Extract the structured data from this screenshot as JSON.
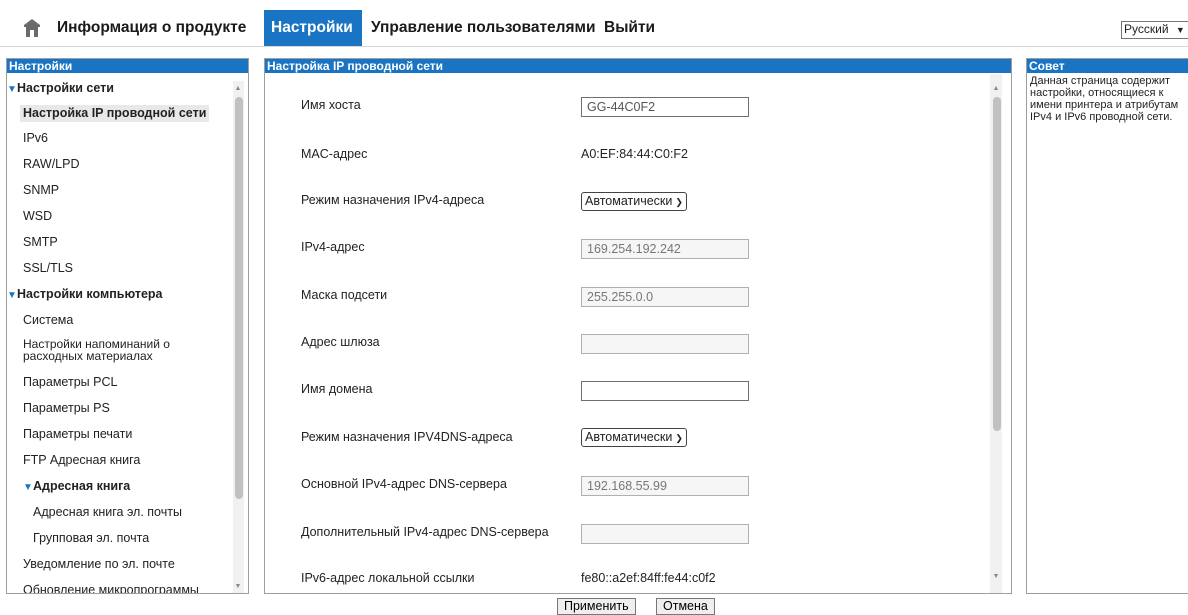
{
  "nav": {
    "product_info": "Информация о продукте",
    "settings": "Настройки",
    "user_management": "Управление пользователями",
    "logout": "Выйти",
    "language": "Русский"
  },
  "sidebar": {
    "title": "Настройки",
    "network_settings": "Настройки сети",
    "wired_ip": "Настройка IP проводной сети",
    "ipv6": "IPv6",
    "rawlpd": "RAW/LPD",
    "snmp": "SNMP",
    "wsd": "WSD",
    "smtp": "SMTP",
    "ssltls": "SSL/TLS",
    "computer_settings": "Настройки компьютера",
    "system": "Система",
    "supply_reminder_l1": "Настройки напоминаний о",
    "supply_reminder_l2": "расходных материалах",
    "pcl": "Параметры PCL",
    "ps": "Параметры PS",
    "print": "Параметры печати",
    "ftp": "FTP Адресная книга",
    "address_book": "Адресная книга",
    "email_book": "Адресная книга эл. почты",
    "group_email": "Групповая эл. почта",
    "email_notify": "Уведомление по эл. почте",
    "firmware": "Обновление микропрограммы"
  },
  "main": {
    "title": "Настройка IP проводной сети",
    "hostname_label": "Имя хоста",
    "hostname_value": "GG-44C0F2",
    "mac_label": "MAC-адрес",
    "mac_value": "A0:EF:84:44:C0:F2",
    "ipv4_mode_label": "Режим назначения IPv4-адреса",
    "ipv4_mode_value": "Автоматически",
    "ipv4_label": "IPv4-адрес",
    "ipv4_value": "169.254.192.242",
    "mask_label": "Маска подсети",
    "mask_value": "255.255.0.0",
    "gateway_label": "Адрес шлюза",
    "gateway_value": "",
    "domain_label": "Имя домена",
    "domain_value": "",
    "dns_mode_label": "Режим назначения IPV4DNS-адреса",
    "dns_mode_value": "Автоматически",
    "dns_primary_label": "Основной IPv4-адрес DNS-сервера",
    "dns_primary_value": "192.168.55.99",
    "dns_secondary_label": "Дополнительный IPv4-адрес DNS-сервера",
    "dns_secondary_value": "",
    "ipv6_link_label": "IPv6-адрес локальной ссылки",
    "ipv6_link_value": "fe80::a2ef:84ff:fe44:c0f2"
  },
  "tip": {
    "title": "Совет",
    "text": "Данная страница содержит настройки, относящиеся к имени принтера и атрибутам IPv4 и IPv6 проводной сети."
  },
  "buttons": {
    "apply": "Применить",
    "cancel": "Отмена"
  }
}
